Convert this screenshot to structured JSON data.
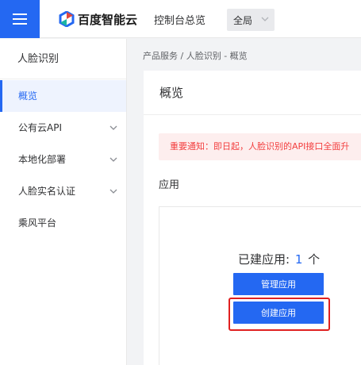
{
  "topbar": {
    "brand": "百度智能云",
    "console_link": "控制台总览",
    "region": "全局"
  },
  "sidebar": {
    "title": "人脸识别",
    "items": [
      {
        "label": "概览",
        "active": true,
        "expandable": false
      },
      {
        "label": "公有云API",
        "active": false,
        "expandable": true
      },
      {
        "label": "本地化部署",
        "active": false,
        "expandable": true
      },
      {
        "label": "人脸实名认证",
        "active": false,
        "expandable": true
      },
      {
        "label": "乘风平台",
        "active": false,
        "expandable": false
      }
    ]
  },
  "breadcrumb": "产品服务 / 人脸识别 - 概览",
  "main": {
    "title": "概览",
    "notice": "重要通知：即日起，人脸识别的API接口全面升",
    "section_label": "应用",
    "app_count_prefix": "已建应用:",
    "app_count": "1",
    "app_count_suffix": "个",
    "manage_button": "管理应用",
    "create_button": "创建应用"
  },
  "colors": {
    "accent": "#2468f2",
    "notice_text": "#f33e3e",
    "notice_bg": "#fdeeee",
    "highlight": "#e02020"
  }
}
